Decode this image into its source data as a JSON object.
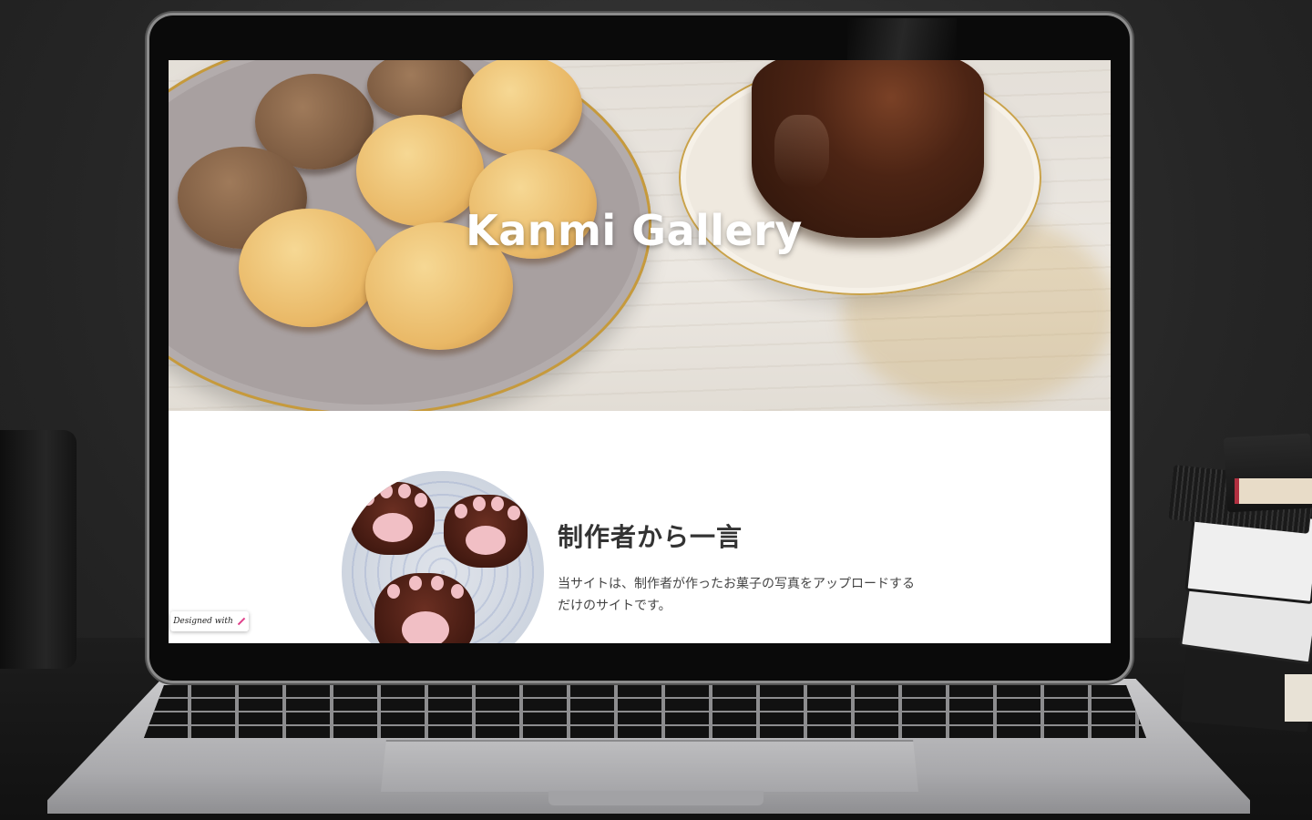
{
  "site": {
    "hero_title": "Kanmi Gallery"
  },
  "about": {
    "heading": "制作者から一言",
    "text": "当サイトは、制作者が作ったお菓子の写真をアップロードするだけのサイトです。"
  },
  "badge": {
    "label": "Designed with"
  },
  "icons": {
    "badge_icon": "pencil-icon"
  },
  "colors": {
    "accent": "#e0408a",
    "hero_text": "#ffffff",
    "heading_text": "#333333"
  }
}
